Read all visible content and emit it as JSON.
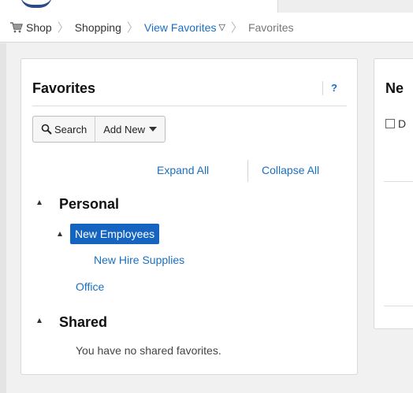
{
  "breadcrumb": {
    "shop": "Shop",
    "shopping": "Shopping",
    "view_favorites": "View Favorites",
    "favorites": "Favorites"
  },
  "favorites_panel": {
    "title": "Favorites",
    "help": "?",
    "search_button": "Search",
    "add_new_button": "Add New",
    "expand_all": "Expand All",
    "collapse_all": "Collapse All",
    "tree": {
      "personal": "Personal",
      "new_employees": "New Employees",
      "new_hire_supplies": "New Hire Supplies",
      "office": "Office",
      "shared": "Shared",
      "no_shared_message": "You have no shared favorites."
    }
  },
  "side_panel": {
    "title": "Ne",
    "checkbox_label": "D"
  },
  "colors": {
    "link": "#1a6fc0",
    "selected_bg": "#1565c0",
    "brand": "#2c4a8a"
  }
}
